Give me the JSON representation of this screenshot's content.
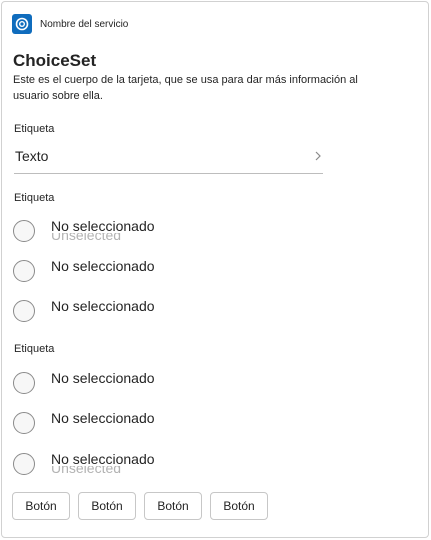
{
  "header": {
    "service_name": "Nombre del servicio",
    "icon": "app-logo-icon",
    "icon_color": "#0f6cbd"
  },
  "card": {
    "title": "ChoiceSet",
    "description": "Este es el cuerpo de la tarjeta, que se usa para dar más información al usuario sobre ella."
  },
  "dropdown_section": {
    "label": "Etiqueta",
    "value": "Texto",
    "icon": "chevron-right-icon"
  },
  "radio_group_1": {
    "label": "Etiqueta",
    "options": [
      "No seleccionado",
      "No seleccionado",
      "No seleccionado"
    ],
    "ghost_text": "Unselected"
  },
  "radio_group_2": {
    "label": "Etiqueta",
    "options": [
      "No seleccionado",
      "No seleccionado",
      "No seleccionado"
    ],
    "ghost_text": "Unselected"
  },
  "actions": [
    "Botón",
    "Botón",
    "Botón",
    "Botón"
  ]
}
